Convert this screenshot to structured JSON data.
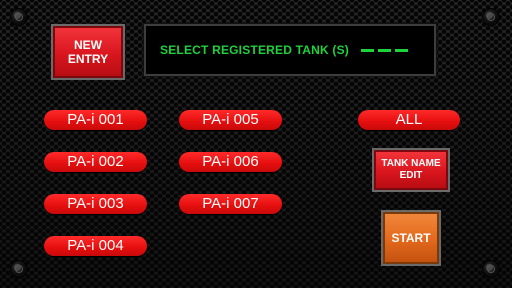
{
  "new_entry": {
    "line1": "NEW",
    "line2": "ENTRY"
  },
  "display": {
    "text": "SELECT REGISTERED TANK (S)"
  },
  "tanks": [
    {
      "label": "PA-i 001"
    },
    {
      "label": "PA-i 002"
    },
    {
      "label": "PA-i 003"
    },
    {
      "label": "PA-i 004"
    },
    {
      "label": "PA-i 005"
    },
    {
      "label": "PA-i 006"
    },
    {
      "label": "PA-i 007"
    }
  ],
  "all_label": "ALL",
  "tank_name_edit": {
    "line1": "TANK NAME",
    "line2": "EDIT"
  },
  "start_label": "START",
  "colors": {
    "button_red": "#e40e0e",
    "start_orange": "#e2681c",
    "display_green": "#1ed23c"
  },
  "icons": [
    "screw-icon"
  ]
}
